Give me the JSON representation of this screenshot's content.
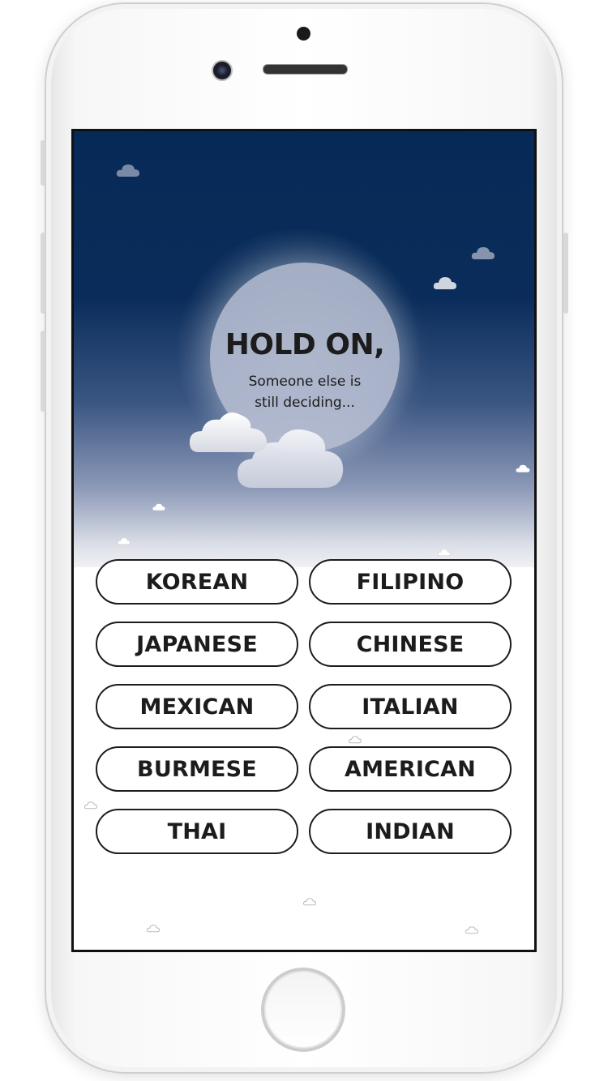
{
  "screen": {
    "title": "HOLD ON,",
    "subtitle": "Someone else is\nstill deciding..."
  },
  "options": [
    {
      "label": "KOREAN"
    },
    {
      "label": "FILIPINO"
    },
    {
      "label": "JAPANESE"
    },
    {
      "label": "CHINESE"
    },
    {
      "label": "MEXICAN"
    },
    {
      "label": "ITALIAN"
    },
    {
      "label": "BURMESE"
    },
    {
      "label": "AMERICAN"
    },
    {
      "label": "THAI"
    },
    {
      "label": "INDIAN"
    }
  ],
  "colors": {
    "sky_top": "#062a57",
    "sky_bottom": "#f1f1f4",
    "text": "#1c1c1c",
    "button_border": "#1c1c1c"
  },
  "icons": {
    "cloud": "cloud-icon",
    "moon": "moon-icon"
  }
}
